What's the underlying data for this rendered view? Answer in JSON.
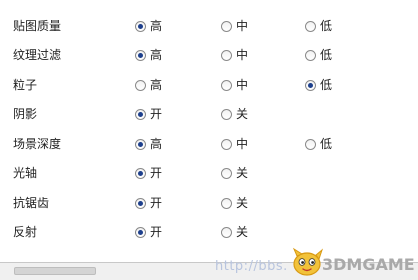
{
  "settings": [
    {
      "label": "贴图质量",
      "options": [
        "高",
        "中",
        "低"
      ],
      "selected": 0
    },
    {
      "label": "纹理过滤",
      "options": [
        "高",
        "中",
        "低"
      ],
      "selected": 0
    },
    {
      "label": "粒子",
      "options": [
        "高",
        "中",
        "低"
      ],
      "selected": 2
    },
    {
      "label": "阴影",
      "options": [
        "开",
        "关"
      ],
      "selected": 0
    },
    {
      "label": "场景深度",
      "options": [
        "高",
        "中",
        "低"
      ],
      "selected": 0
    },
    {
      "label": "光轴",
      "options": [
        "开",
        "关"
      ],
      "selected": 0
    },
    {
      "label": "抗锯齿",
      "options": [
        "开",
        "关"
      ],
      "selected": 0
    },
    {
      "label": "反射",
      "options": [
        "开",
        "关"
      ],
      "selected": 0
    }
  ],
  "watermark": {
    "url": "http://bbs.",
    "brand": "3DMGAME"
  },
  "colors": {
    "radio_dot": "#1d3f8c",
    "background": "#ffffff",
    "text": "#222222"
  }
}
